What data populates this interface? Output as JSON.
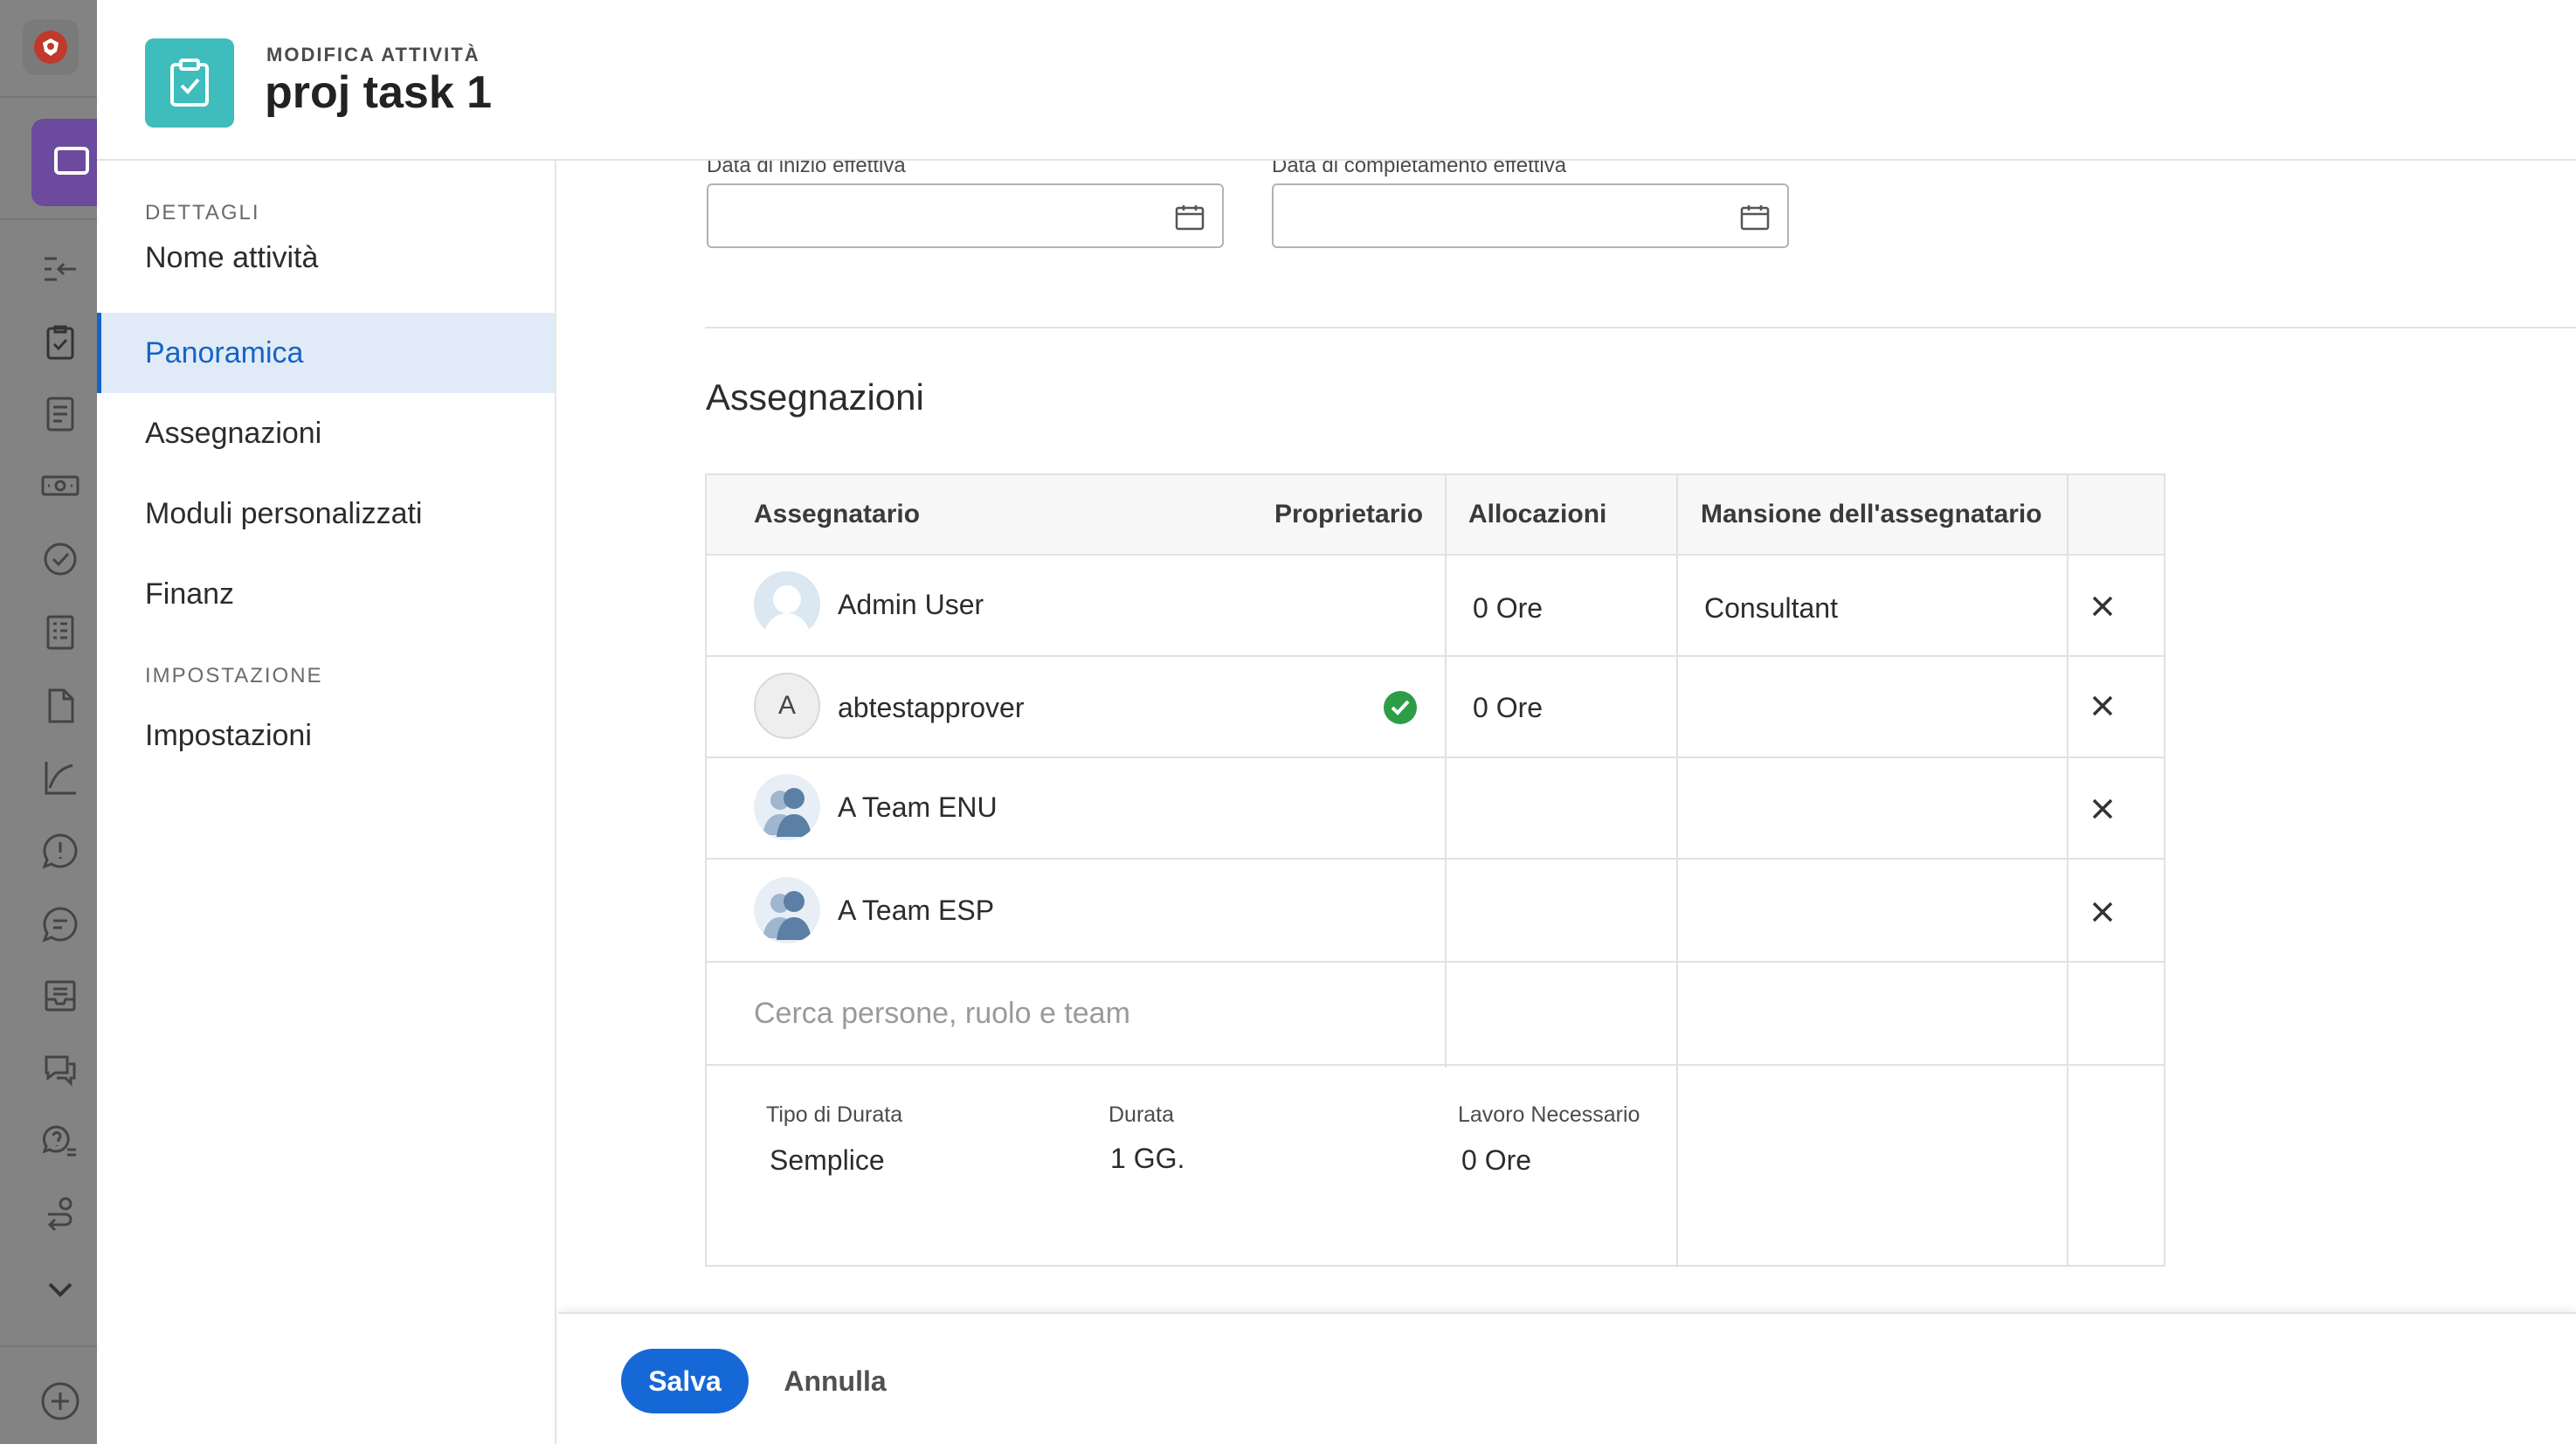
{
  "header": {
    "eyebrow": "MODIFICA ATTIVITÀ",
    "title": "proj task 1"
  },
  "nav": {
    "section_details": "DETTAGLI",
    "items": [
      {
        "label": "Nome attività",
        "active": false
      },
      {
        "label": "Panoramica",
        "active": true
      },
      {
        "label": "Assegnazioni",
        "active": false
      },
      {
        "label": "Moduli personalizzati",
        "active": false
      },
      {
        "label": "Finanz",
        "active": false
      }
    ],
    "section_settings": "IMPOSTAZIONE",
    "settings_item": "Impostazioni"
  },
  "dates": {
    "start_label": "Data di inizio effettiva",
    "completion_label": "Data di completamento effettiva",
    "start_value": "",
    "completion_value": ""
  },
  "assignments": {
    "title": "Assegnazioni",
    "columns": {
      "assignee": "Assegnatario",
      "owner": "Proprietario",
      "allocations": "Allocazioni",
      "role": "Mansione dell'assegnatario"
    },
    "rows": [
      {
        "name": "Admin User",
        "avatar": "user-photo",
        "avatar_letter": "",
        "owner": false,
        "allocation": "0 Ore",
        "role": "Consultant"
      },
      {
        "name": "abtestapprover",
        "avatar": "letter",
        "avatar_letter": "A",
        "owner": true,
        "allocation": "0 Ore",
        "role": ""
      },
      {
        "name": "A Team ENU",
        "avatar": "team-icon",
        "avatar_letter": "",
        "owner": false,
        "allocation": "",
        "role": ""
      },
      {
        "name": "A Team ESP",
        "avatar": "team-icon",
        "avatar_letter": "",
        "owner": false,
        "allocation": "",
        "role": ""
      }
    ],
    "search_placeholder": "Cerca persone, ruolo e team",
    "duration_type_label": "Tipo di Durata",
    "duration_type_value": "Semplice",
    "duration_label": "Durata",
    "duration_value": "1 GG.",
    "work_label": "Lavoro Necessario",
    "work_value": "0 Ore"
  },
  "footer": {
    "save_label": "Salva",
    "cancel_label": "Annulla"
  },
  "colors": {
    "accent": "#1668d6",
    "nav_active_bg": "#e1ebf7",
    "badge": "#3fbcbc",
    "rail": "#838383",
    "owner_check": "#2d9d46"
  },
  "rail_icons": [
    "brand-logo-icon",
    "app-switcher-icon",
    "collapse-icon",
    "task-icon",
    "document-icon",
    "finance-icon",
    "approval-icon",
    "report-icon",
    "file-icon",
    "chart-icon",
    "issue-icon",
    "comment-icon",
    "inbox-icon",
    "discussion-icon",
    "help-icon",
    "workflow-icon",
    "chevron-down-icon",
    "add-icon"
  ]
}
